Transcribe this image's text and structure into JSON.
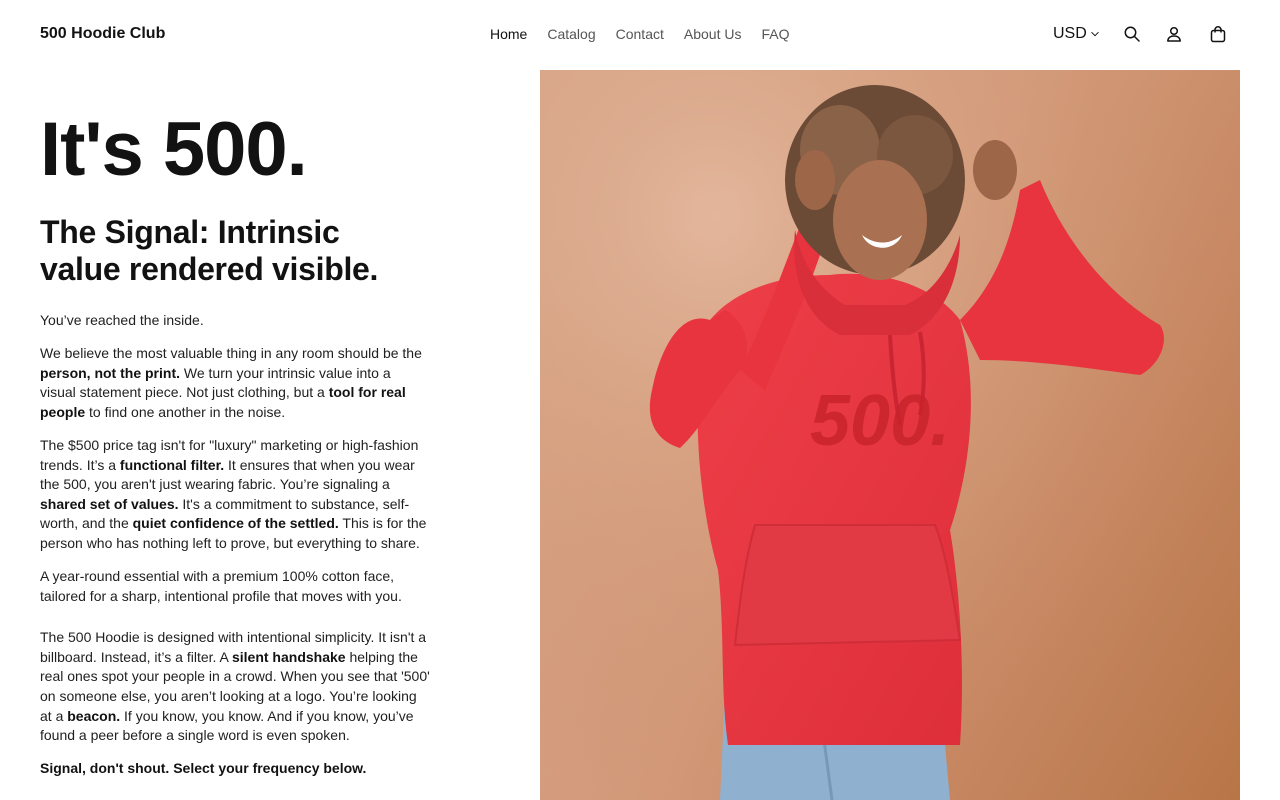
{
  "header": {
    "brand": "500 Hoodie Club",
    "nav": [
      {
        "label": "Home",
        "active": true
      },
      {
        "label": "Catalog",
        "active": false
      },
      {
        "label": "Contact",
        "active": false
      },
      {
        "label": "About Us",
        "active": false
      },
      {
        "label": "FAQ",
        "active": false
      }
    ],
    "currency": "USD",
    "icons": [
      "search-icon",
      "account-icon",
      "cart-icon"
    ]
  },
  "hero": {
    "title": "It's 500.",
    "subheading": "The Signal: Intrinsic value rendered visible."
  },
  "body": {
    "p1": "You’ve reached the inside.",
    "p2_a": "We believe the most valuable thing in any room should be the ",
    "p2_b": "person, not the print.",
    "p2_c": " We turn your intrinsic value into a visual statement piece. Not just clothing, but a ",
    "p2_d": "tool for real people",
    "p2_e": " to find one another in the noise.",
    "p3_a": "The $500 price tag isn't for \"luxury\" marketing or high-fashion trends. It’s a ",
    "p3_b": "functional filter.",
    "p3_c": " It ensures that when you wear the 500, you aren't just wearing fabric. You’re signaling a ",
    "p3_d": "shared set of values.",
    "p3_e": " It's a commitment to substance, self-worth, and the ",
    "p3_f": "quiet confidence of the settled.",
    "p3_g": " This is for the person who has nothing left to prove, but everything to share.",
    "p4": "A year-round essential with a premium 100% cotton face, tailored for a sharp, intentional profile that moves with you.",
    "p5_a": "The 500 Hoodie is designed with intentional simplicity. It isn't a billboard. Instead, it’s a filter. A ",
    "p5_b": "silent handshake",
    "p5_c": " helping the real ones spot your people in a crowd. When you see that '500' on someone else, you aren’t looking at a logo. You’re looking at a ",
    "p5_d": "beacon.",
    "p5_e": " If you know, you know. And if you know, you’ve found a peer before a single word is even spoken.",
    "closing": "Signal, don't shout. Select your frequency below."
  },
  "product_image": {
    "hoodie_print": "500.",
    "hoodie_color": "#e8343f",
    "background_color": "#d39a7a"
  }
}
